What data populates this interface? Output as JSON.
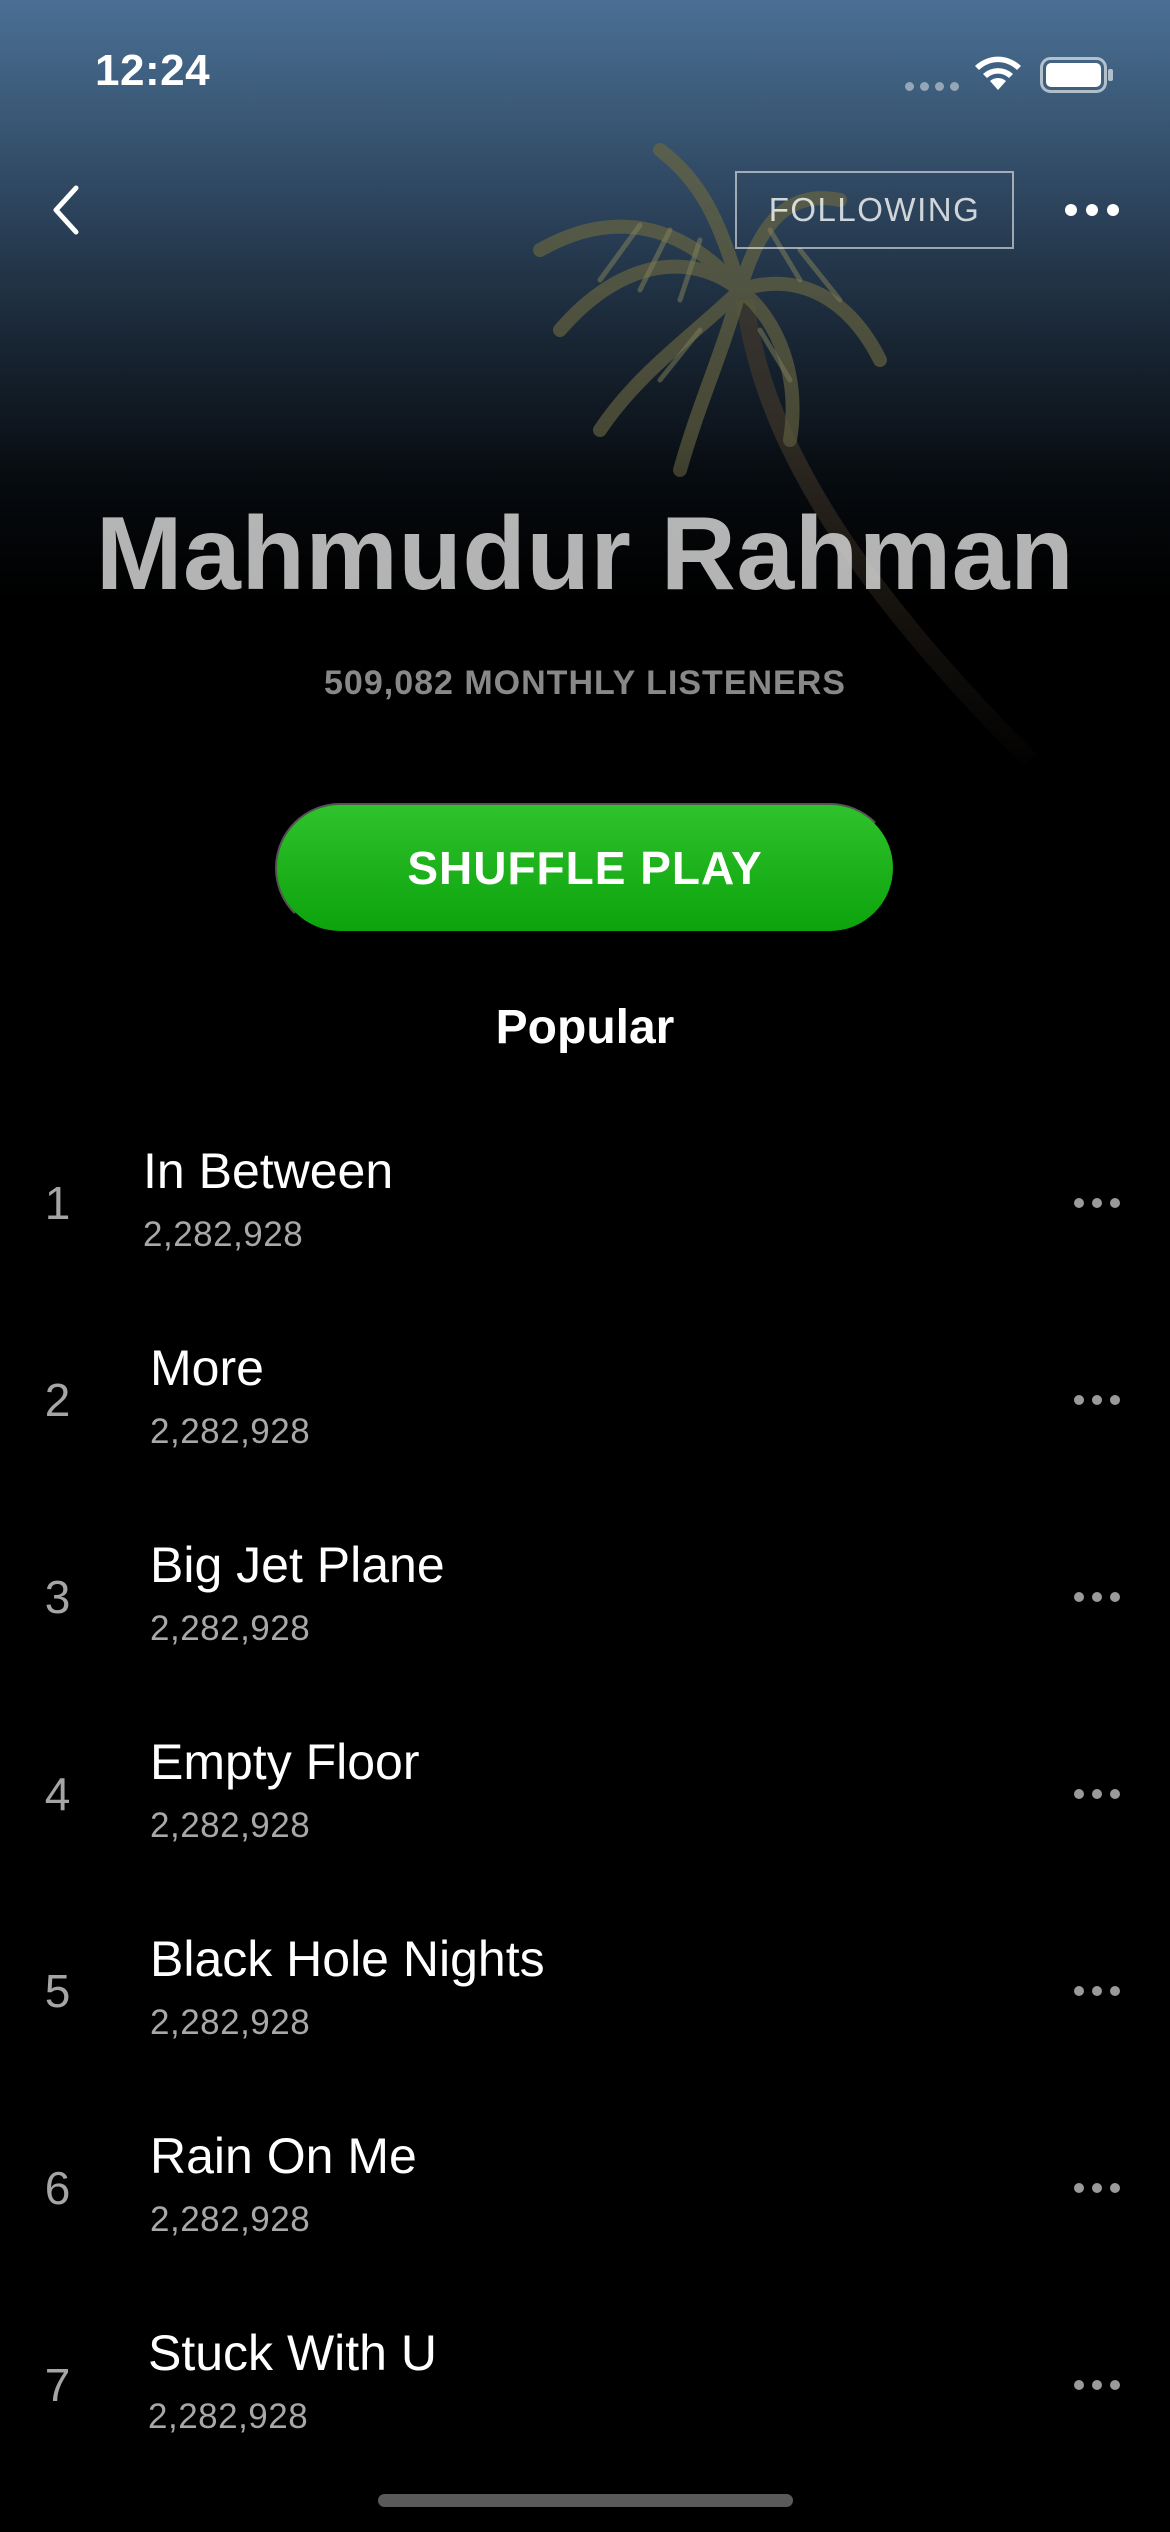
{
  "status_bar": {
    "time": "12:24"
  },
  "header": {
    "following_label": "FOLLOWING"
  },
  "artist": {
    "name": "Mahmudur Rahman",
    "listeners": "509,082 MONTHLY LISTENERS"
  },
  "actions": {
    "shuffle_label": "SHUFFLE PLAY"
  },
  "popular": {
    "title": "Popular",
    "tracks": [
      {
        "num": "1",
        "title": "In Between",
        "plays": "2,282,928"
      },
      {
        "num": "2",
        "title": "More",
        "plays": "2,282,928"
      },
      {
        "num": "3",
        "title": "Big Jet Plane",
        "plays": "2,282,928"
      },
      {
        "num": "4",
        "title": "Empty Floor",
        "plays": "2,282,928"
      },
      {
        "num": "5",
        "title": "Black Hole Nights",
        "plays": "2,282,928"
      },
      {
        "num": "6",
        "title": "Rain On Me",
        "plays": "2,282,928"
      },
      {
        "num": "7",
        "title": "Stuck With U",
        "plays": "2,282,928"
      }
    ]
  },
  "icons": {
    "back": "chevron-left-icon",
    "more": "more-horizontal-icon",
    "wifi": "wifi-icon",
    "battery": "battery-icon",
    "signal": "cellular-signal-icon"
  },
  "colors": {
    "accent": "#1db954",
    "shuffle_top": "#2fc22c",
    "shuffle_bottom": "#0ca30c",
    "background": "#000000",
    "secondary_text": "#a8a8a8"
  }
}
